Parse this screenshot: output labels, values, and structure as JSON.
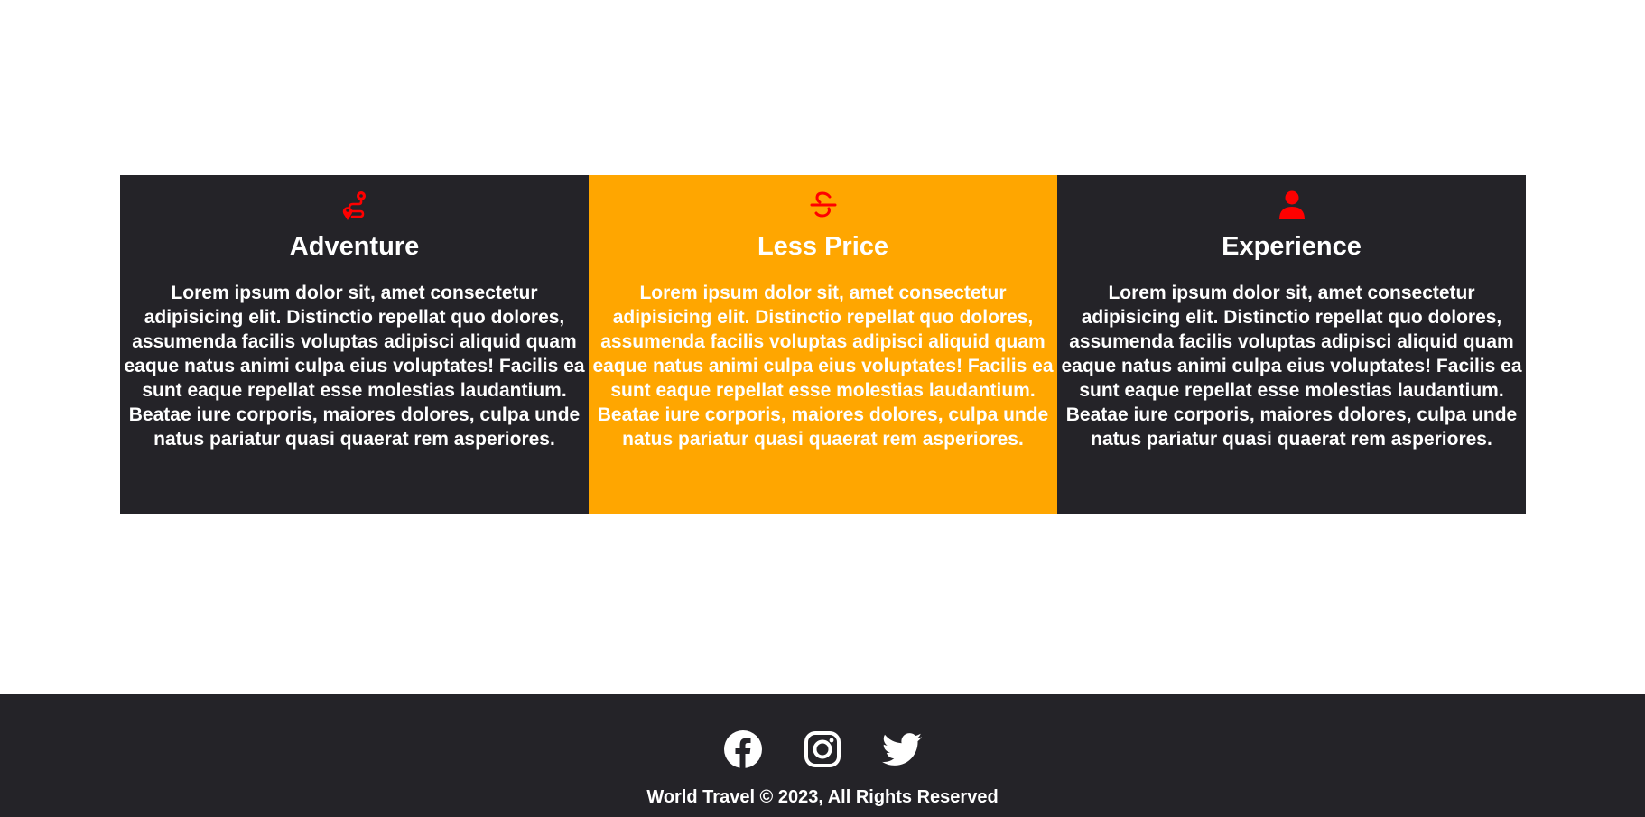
{
  "features": [
    {
      "icon": "route-icon",
      "title": "Adventure",
      "text": "Lorem ipsum dolor sit, amet consectetur adipisicing elit. Distinctio repellat quo dolores, assumenda facilis voluptas adipisci aliquid quam eaque natus animi culpa eius voluptates! Facilis ea sunt eaque repellat esse molestias laudantium. Beatae iure corporis, maiores dolores, culpa unde natus pariatur quasi quaerat rem asperiores."
    },
    {
      "icon": "strikethrough-s-icon",
      "title": "Less Price",
      "text": "Lorem ipsum dolor sit, amet consectetur adipisicing elit. Distinctio repellat quo dolores, assumenda facilis voluptas adipisci aliquid quam eaque natus animi culpa eius voluptates! Facilis ea sunt eaque repellat esse molestias laudantium. Beatae iure corporis, maiores dolores, culpa unde natus pariatur quasi quaerat rem asperiores."
    },
    {
      "icon": "user-icon",
      "title": "Experience",
      "text": "Lorem ipsum dolor sit, amet consectetur adipisicing elit. Distinctio repellat quo dolores, assumenda facilis voluptas adipisci aliquid quam eaque natus animi culpa eius voluptates! Facilis ea sunt eaque repellat esse molestias laudantium. Beatae iure corporis, maiores dolores, culpa unde natus pariatur quasi quaerat rem asperiores."
    }
  ],
  "footer": {
    "socials": [
      "facebook-icon",
      "instagram-icon",
      "twitter-icon"
    ],
    "copyright": "World Travel © 2023, All Rights Reserved"
  },
  "colors": {
    "card_dark": "#242328",
    "card_accent": "#ffa600",
    "icon": "#ff0000",
    "footer": "#242328",
    "text": "#ffffff"
  }
}
